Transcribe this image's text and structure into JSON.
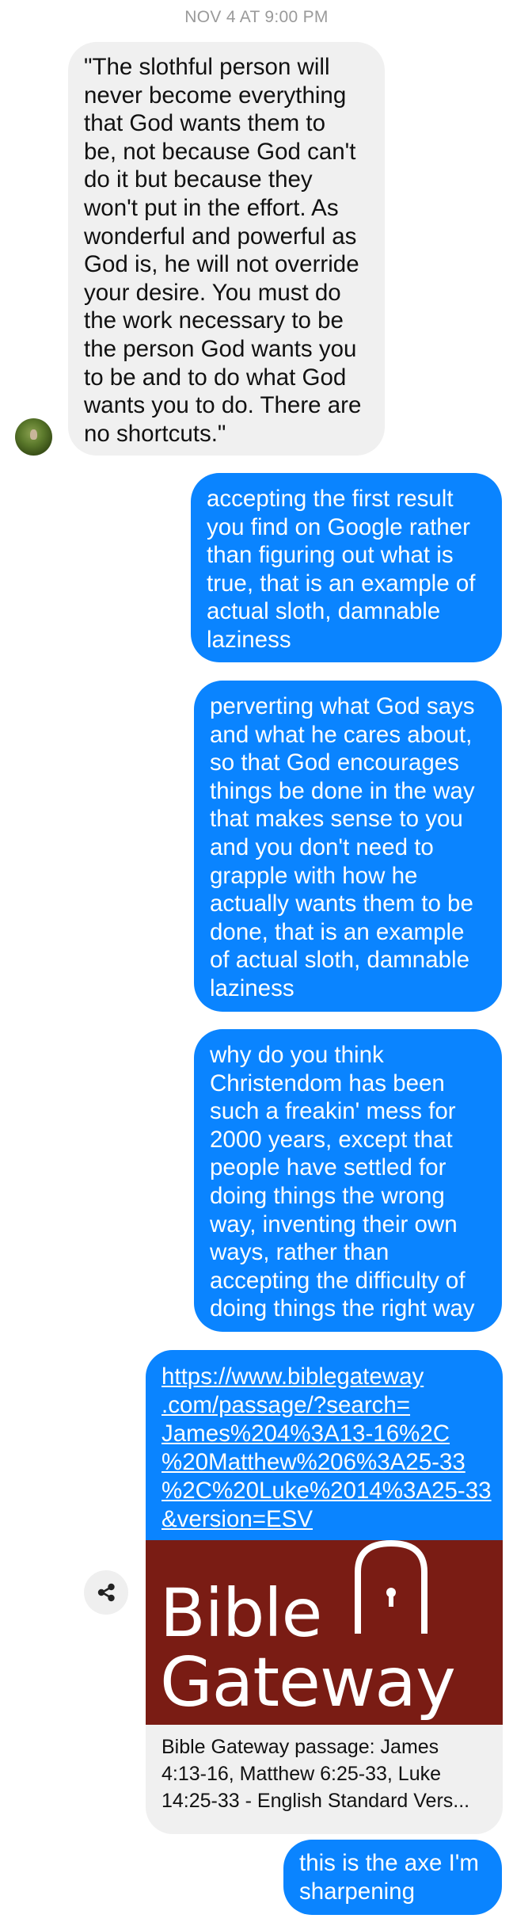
{
  "thread": {
    "timestamp": "NOV 4 AT 9:00 PM"
  },
  "messages": [
    {
      "direction": "incoming",
      "text": "\"The slothful person will\nnever become everything\nthat God wants them to\nbe, not because God can't\ndo it but because they\nwon't put in the effort. As\nwonderful and powerful as\nGod is, he will not override\nyour desire. You must do\nthe work necessary to be\nthe person God wants you\nto be and to do what God\nwants you to do. There are\nno shortcuts.\""
    },
    {
      "direction": "outgoing",
      "text": "accepting the first result\nyou find on Google rather\nthan figuring out what is\ntrue, that is an example of\nactual sloth, damnable\nlaziness"
    },
    {
      "direction": "outgoing",
      "text": "perverting what God says\nand what he cares about,\nso that God encourages\nthings be done in the way\nthat makes sense to you\nand you don't need to\ngrapple with how he\nactually wants them to be\ndone, that is an example\nof actual sloth, damnable\nlaziness"
    },
    {
      "direction": "outgoing",
      "text": "why do you think\nChristendom has been\nsuch a freakin' mess for\n2000 years, except that\npeople have settled for\ndoing things the wrong\nway, inventing their own\nways, rather than\naccepting the difficulty of\ndoing things the right way"
    },
    {
      "direction": "outgoing",
      "text": "this is the axe I'm\nsharpening"
    }
  ],
  "link_preview": {
    "url": "https://www.biblegateway\n.com/passage/?search=\nJames%204%3A13-16%2C\n%20Matthew%206%3A25-33\n%2C%20Luke%2014%3A25-33\n&version=ESV",
    "logo_line1": "Bible",
    "logo_line2": "Gateway",
    "title": "Bible Gateway passage: James\n4:13-16, Matthew 6:25-33, Luke\n14:25-33 - English Standard Vers...",
    "logo_bg_color": "#7a1c14"
  },
  "icons": {
    "share": "share-icon",
    "avatar": "contact-avatar"
  },
  "colors": {
    "outgoing_bubble": "#0a84ff",
    "incoming_bubble": "#f0f0f0",
    "timestamp": "#9a9a9a"
  }
}
